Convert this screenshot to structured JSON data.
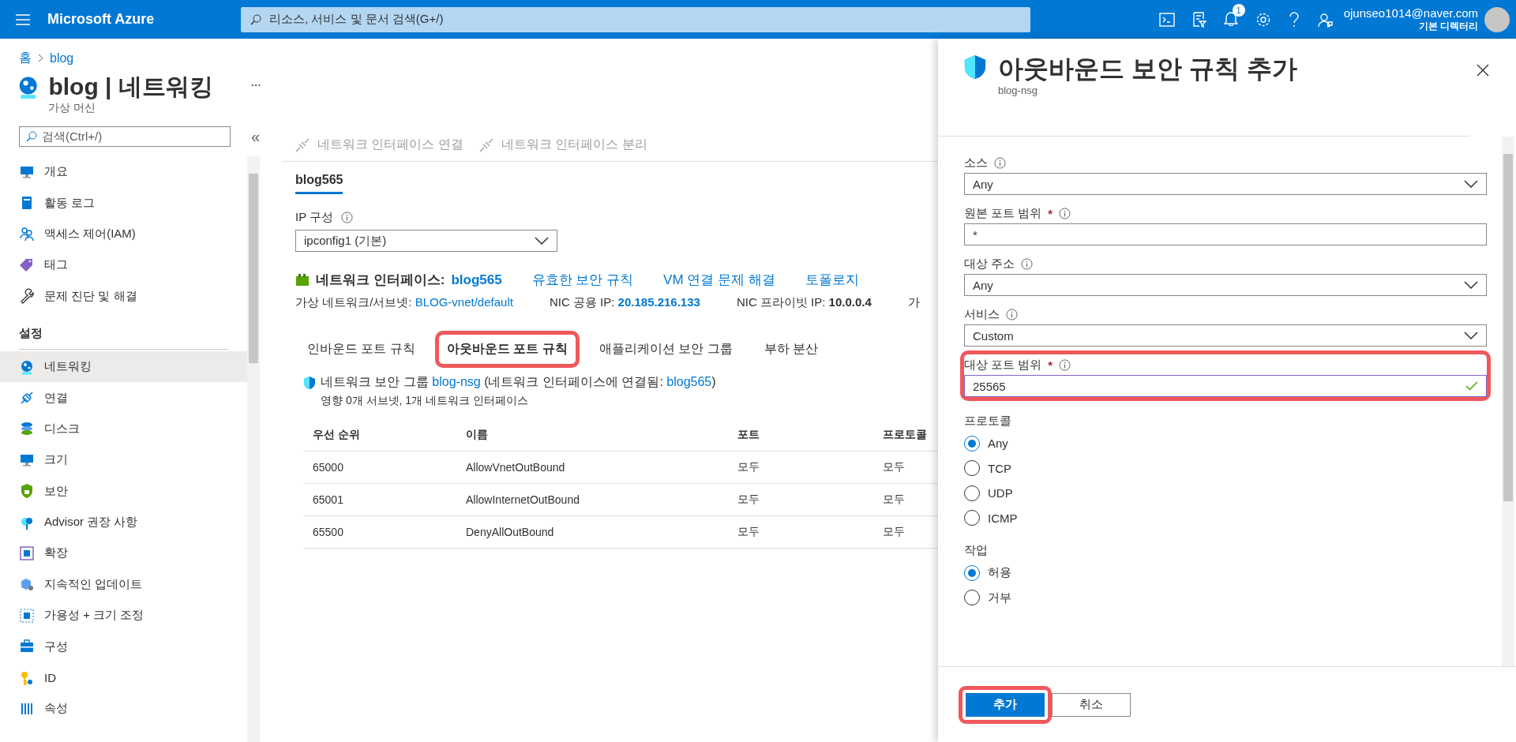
{
  "top_bar": {
    "brand": "Microsoft Azure",
    "search": {
      "placeholder": "리소스, 서비스 및 문서 검색(G+/)"
    },
    "notification_count": "1",
    "account": {
      "email": "ojunseo1014@naver.com",
      "directory": "기본 디렉터리"
    }
  },
  "breadcrumb": [
    "홈",
    "blog"
  ],
  "header": {
    "title": "blog | 네트워킹",
    "subtitle": "가상 머신"
  },
  "sidebar": {
    "search": {
      "placeholder": "검색(Ctrl+/)"
    },
    "collapse": "«",
    "items": [
      {
        "kind": "item",
        "label": "개요",
        "selected": false
      },
      {
        "kind": "item",
        "label": "활동 로그",
        "selected": false
      },
      {
        "kind": "item",
        "label": "액세스 제어(IAM)",
        "selected": false
      },
      {
        "kind": "item",
        "label": "태그",
        "selected": false
      },
      {
        "kind": "item",
        "label": "문제 진단 및 해결",
        "selected": false
      },
      {
        "kind": "section",
        "label": "설정"
      },
      {
        "kind": "item",
        "label": "네트워킹",
        "selected": true
      },
      {
        "kind": "item",
        "label": "연결",
        "selected": false
      },
      {
        "kind": "item",
        "label": "디스크",
        "selected": false
      },
      {
        "kind": "item",
        "label": "크기",
        "selected": false
      },
      {
        "kind": "item",
        "label": "보안",
        "selected": false
      },
      {
        "kind": "item",
        "label": "Advisor 권장 사항",
        "selected": false
      },
      {
        "kind": "item",
        "label": "확장",
        "selected": false
      },
      {
        "kind": "item",
        "label": "지속적인 업데이트",
        "selected": false
      },
      {
        "kind": "item",
        "label": "가용성 + 크기 조정",
        "selected": false
      },
      {
        "kind": "item",
        "label": "구성",
        "selected": false
      },
      {
        "kind": "item",
        "label": "ID",
        "selected": false
      },
      {
        "kind": "item",
        "label": "속성",
        "selected": false
      }
    ]
  },
  "toolbar": [
    {
      "label": "네트워크 인터페이스 연결",
      "disabled": true
    },
    {
      "label": "네트워크 인터페이스 분리",
      "disabled": true
    }
  ],
  "nic_tabs": [
    {
      "label": "blog565",
      "selected": true
    }
  ],
  "ip_config": {
    "label": "IP 구성",
    "value": "ipconfig1 (기본)"
  },
  "nic": {
    "label": "네트워크 인터페이스:",
    "name": "blog565",
    "links": [
      "유효한 보안 규칙",
      "VM 연결 문제 해결",
      "토폴로지"
    ]
  },
  "details": [
    {
      "kind": "link",
      "label": "가상 네트워크/서브넷:",
      "value": "BLOG-vnet/default"
    },
    {
      "kind": "link-bold",
      "label": "NIC 공용 IP:",
      "value": "20.185.216.133"
    },
    {
      "kind": "bold",
      "label": "NIC 프라이빗 IP:",
      "value": "10.0.0.4"
    },
    {
      "kind": "plain",
      "label": "가"
    }
  ],
  "rule_tabs": [
    {
      "label": "인바운드 포트 규칙",
      "selected": false,
      "highlighted": false
    },
    {
      "label": "아웃바운드 포트 규칙",
      "selected": true,
      "highlighted": true
    },
    {
      "label": "애플리케이션 보안 그룹",
      "selected": false,
      "highlighted": false
    },
    {
      "label": "부하 분산",
      "selected": false,
      "highlighted": false
    }
  ],
  "nsg": {
    "label": "네트워크 보안 그룹",
    "name": "blog-nsg",
    "attached_prefix": "(네트워크 인터페이스에 연결됨:",
    "attached": "blog565",
    "attached_suffix": ")",
    "impact": "영향 0개 서브넷, 1개 네트워크 인터페이스"
  },
  "table": {
    "columns": [
      "우선 순위",
      "이름",
      "포트",
      "프로토콜"
    ],
    "rows": [
      [
        "65000",
        "AllowVnetOutBound",
        "모두",
        "모두"
      ],
      [
        "65001",
        "AllowInternetOutBound",
        "모두",
        "모두"
      ],
      [
        "65500",
        "DenyAllOutBound",
        "모두",
        "모두"
      ]
    ]
  },
  "panel": {
    "title": "아웃바운드 보안 규칙 추가",
    "subtitle": "blog-nsg",
    "fields": [
      {
        "kind": "select",
        "label": "소스",
        "info": true,
        "value": "Any",
        "highlighted": false
      },
      {
        "kind": "input",
        "label": "원본 포트 범위",
        "required_mark": "*",
        "info": true,
        "value": "*",
        "valid": false,
        "highlighted": false
      },
      {
        "kind": "select",
        "label": "대상 주소",
        "info": true,
        "value": "Any",
        "highlighted": false
      },
      {
        "kind": "select",
        "label": "서비스",
        "info": true,
        "value": "Custom",
        "highlighted": false
      },
      {
        "kind": "input",
        "label": "대상 포트 범위",
        "required_mark": "*",
        "info": true,
        "value": "25565",
        "valid": true,
        "highlighted": true
      },
      {
        "kind": "radio",
        "label": "프로토콜",
        "info": false,
        "options": [
          {
            "label": "Any",
            "selected": true
          },
          {
            "label": "TCP",
            "selected": false
          },
          {
            "label": "UDP",
            "selected": false
          },
          {
            "label": "ICMP",
            "selected": false
          }
        ]
      },
      {
        "kind": "radio",
        "label": "작업",
        "info": false,
        "options": [
          {
            "label": "허용",
            "selected": true
          },
          {
            "label": "거부",
            "selected": false
          }
        ]
      }
    ],
    "buttons": [
      {
        "label": "추가",
        "primary": true,
        "highlighted": true
      },
      {
        "label": "취소",
        "primary": false,
        "highlighted": false
      }
    ]
  }
}
